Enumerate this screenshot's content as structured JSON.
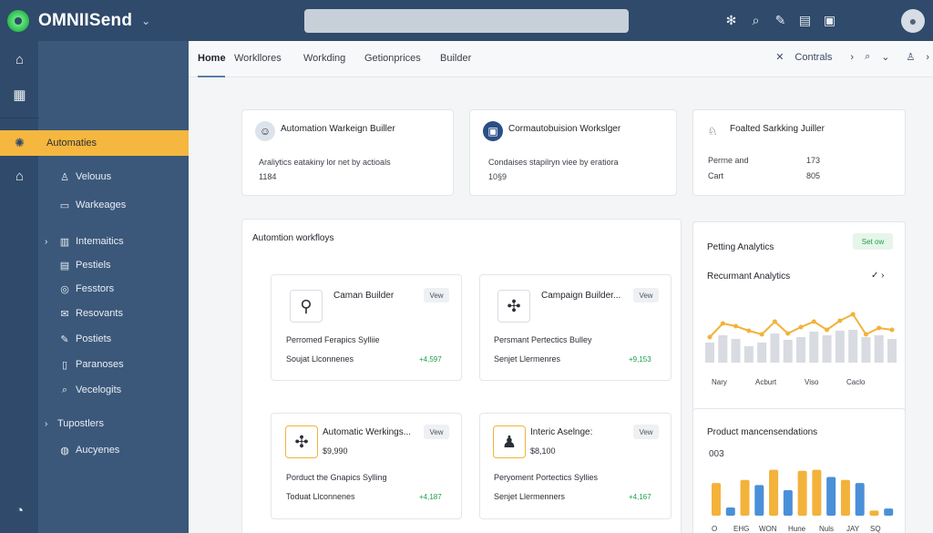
{
  "app": {
    "brand": "OMNIISend",
    "brand_chevron": "⌄",
    "top_icons": [
      "settings-icon",
      "search-icon",
      "edit-icon",
      "clipboard-icon",
      "bag-icon"
    ],
    "colors": {
      "topbar": "#2f4a6b",
      "sidebar": "#3b587a",
      "accent": "#f5b73f",
      "positive": "#1e9e4a"
    }
  },
  "sidebar": {
    "active": "Automaties",
    "items": [
      {
        "label": "Velouus",
        "icon": "user-icon"
      },
      {
        "label": "Warkeages",
        "icon": "message-icon"
      },
      {
        "label": "Intemaitics",
        "icon": "chart-icon",
        "caret": "›"
      },
      {
        "label": "Pestiels",
        "icon": "list-icon"
      },
      {
        "label": "Fesstors",
        "icon": "bubble-icon"
      },
      {
        "label": "Resovants",
        "icon": "mail-icon"
      },
      {
        "label": "Postiets",
        "icon": "edit-icon"
      },
      {
        "label": "Paranoses",
        "icon": "file-icon"
      },
      {
        "label": "Vecelogits",
        "icon": "search-icon"
      },
      {
        "label": "Tupostlers",
        "icon": "",
        "caret": "›"
      },
      {
        "label": "Aucyenes",
        "icon": "globe-icon"
      }
    ]
  },
  "tabs": {
    "items": [
      "Home",
      "Workllores",
      "Workding",
      "Getionprices",
      "Builder"
    ],
    "right_label": "Contrals",
    "close": "✕"
  },
  "summary_cards": [
    {
      "title": "Automation Warkeign Builler",
      "line1": "Araliytics eatakiny lor net by actioals",
      "line2": "1184"
    },
    {
      "title": "Cormautobuision Workslger",
      "line1": "Condaises stapilryn viee by eratiora",
      "line2": "10§9"
    },
    {
      "title": "Foalted Sarkking Juiller",
      "row1_label": "Perrne and",
      "row1_value": "173",
      "row2_label": "Cart",
      "row2_value": "805"
    }
  ],
  "workflows": {
    "heading": "Automtion workfloys",
    "view_label": "Vew",
    "cards": [
      {
        "title": "Caman Builder",
        "line1": "Perromed Ferapics Sylliie",
        "line2": "Soujat Llconnenes",
        "delta": "+4,597"
      },
      {
        "title": "Campaign Builder...",
        "line1": "Persmant Pertectics Bulley",
        "line2": "Senjet Llermenres",
        "delta": "+9,153"
      },
      {
        "title": "Automatic Werkings...",
        "value": "$9,990",
        "line1": "Porduct the Gnapics Sylling",
        "line2": "Toduat Llconnenes",
        "delta": "+4,187"
      },
      {
        "title": "Interic Aselnge:",
        "value": "$8,100",
        "line1": "Peryoment Portectics Syllies",
        "line2": "Senjet Llermenners",
        "delta": "+4,167"
      }
    ]
  },
  "analytics": {
    "title": "Petting Analytics",
    "set_now": "Set ow",
    "subtitle": "Recurmant Analytics",
    "chevrons": "✓ ›"
  },
  "products": {
    "title": "Product mancensendations",
    "value": "003"
  },
  "chart_data": [
    {
      "type": "line",
      "title": "Recurmant Analytics",
      "categories": [
        "Nary",
        "Acburt",
        "Viso",
        "Caclo"
      ],
      "series": [
        {
          "values": [
            28,
            43,
            40,
            35,
            31,
            45,
            32,
            39,
            45,
            36,
            46,
            53,
            31,
            38,
            36
          ]
        }
      ],
      "bars": [
        22,
        30,
        26,
        18,
        22,
        32,
        25,
        28,
        34,
        30,
        35,
        36,
        28,
        30,
        26
      ],
      "colors": [
        "#f3b23a",
        "#d8dbe1"
      ]
    },
    {
      "type": "bar",
      "title": "Product mancensendations",
      "categories": [
        "O",
        "EHG",
        "WON",
        "Hune",
        "Nuls",
        "JAY",
        "SQ"
      ],
      "series": [
        {
          "values": [
            32,
            8,
            35,
            30,
            45,
            25,
            44,
            45,
            38,
            35,
            32,
            5,
            7
          ]
        }
      ],
      "bar_colors": [
        "#f3b23a",
        "#4a90d9",
        "#f3b23a",
        "#4a90d9",
        "#f3b23a",
        "#4a90d9",
        "#f3b23a",
        "#f3b23a",
        "#4a90d9",
        "#f3b23a",
        "#4a90d9",
        "#f3b23a",
        "#4a90d9"
      ]
    }
  ]
}
